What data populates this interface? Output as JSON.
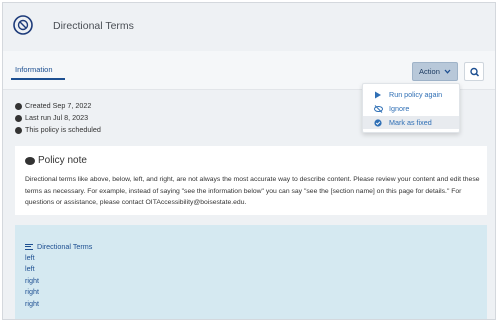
{
  "header": {
    "title": "Directional Terms"
  },
  "tabs": [
    {
      "label": "Information"
    }
  ],
  "toolbar": {
    "action_label": "Action"
  },
  "action_menu": {
    "items": [
      {
        "label": "Run policy again",
        "icon": "play-icon"
      },
      {
        "label": "Ignore",
        "icon": "eye-slash-icon"
      },
      {
        "label": "Mark as fixed",
        "icon": "check-circle-icon"
      }
    ]
  },
  "meta": {
    "created": "Created Sep 7, 2022",
    "last_run": "Last run Jul 8, 2023",
    "scheduled": "This policy is scheduled"
  },
  "policy_note": {
    "title": "Policy note",
    "body": "Directional terms like above, below, left, and right, are not always the most accurate way to describe content. Please review your content and edit these terms as necessary. For example, instead of saying \"see the information below\" you can say \"see the [section name] on this page for details.\" For questions or assistance, please contact OITAccessibility@boisestate.edu."
  },
  "terms": {
    "title": "Directional Terms",
    "items": [
      "left",
      "left",
      "right",
      "right",
      "right"
    ]
  },
  "colors": {
    "accent": "#1d4f91",
    "link": "#2f6fb5",
    "terms_bg": "#d5e9f1"
  }
}
